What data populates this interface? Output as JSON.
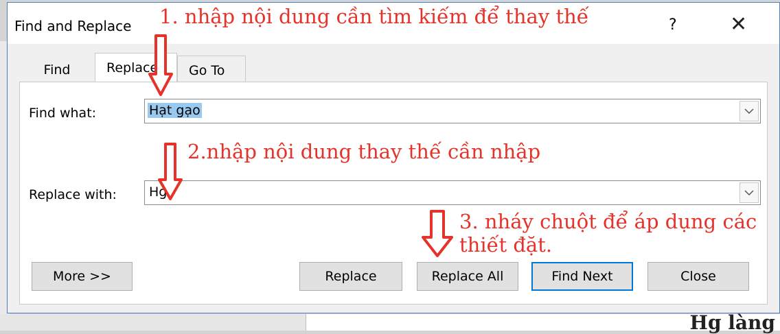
{
  "dialog": {
    "title": "Find and Replace",
    "help_label": "?",
    "close_glyph": "✕"
  },
  "tabs": [
    {
      "label": "Find"
    },
    {
      "label": "Replace"
    },
    {
      "label": "Go To"
    }
  ],
  "find_what": {
    "label": "Find what:",
    "value": "Hạt gạo"
  },
  "replace_with": {
    "label": "Replace with:",
    "value": "Hg"
  },
  "buttons": {
    "more": "More >>",
    "replace": "Replace",
    "replace_all": "Replace All",
    "find_next": "Find Next",
    "close": "Close"
  },
  "annotations": {
    "step1": "1. nhập nội dung cần tìm kiếm để thay thế",
    "step2": "2.nhập nội dung thay thế cần nhập",
    "step3_line1": "3. nháy chuột để áp dụng các",
    "step3_line2": "thiết đặt."
  },
  "background": {
    "doc_text": "Hg làng"
  },
  "colors": {
    "annotation_red": "#e5322a",
    "selection": "#99c9ef",
    "default_button_border": "#0078d7"
  }
}
